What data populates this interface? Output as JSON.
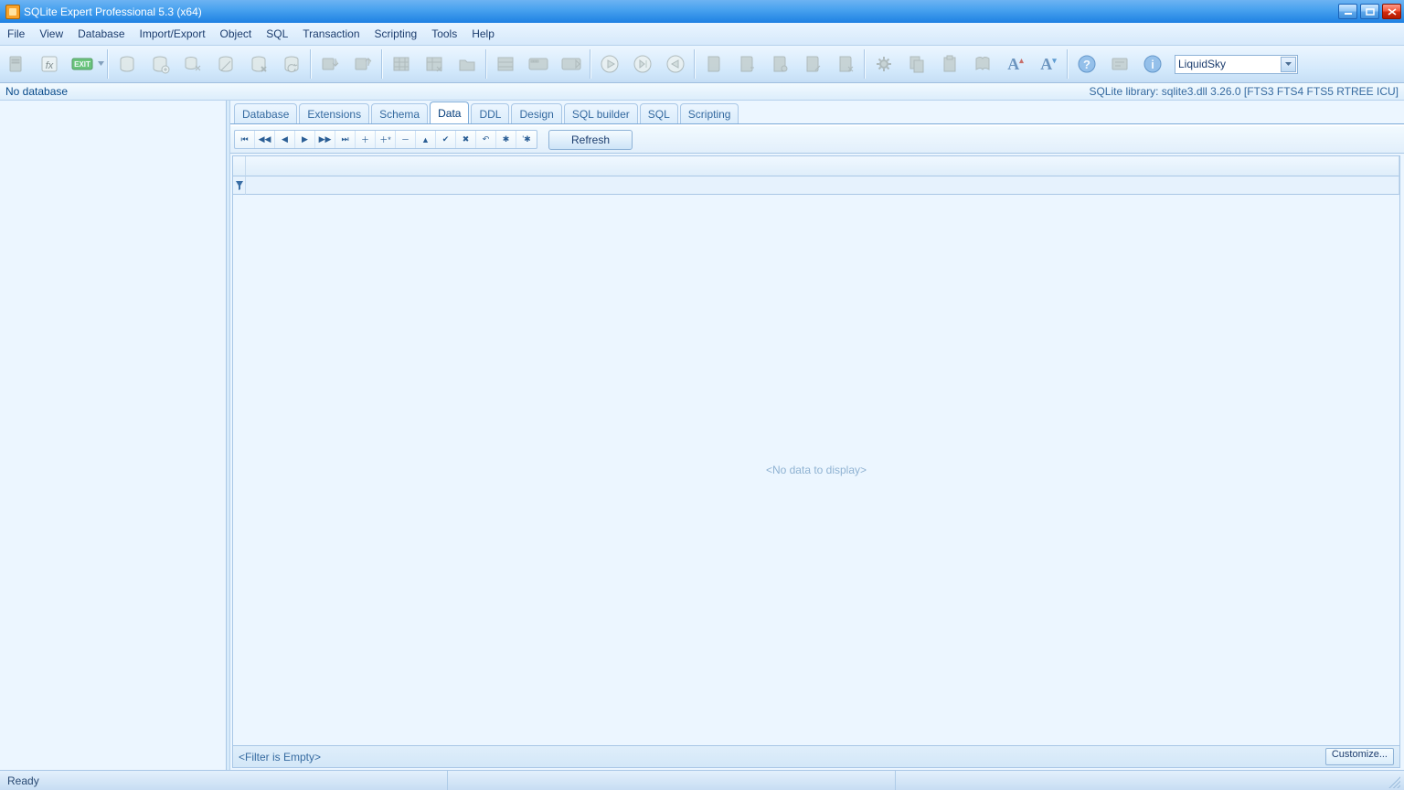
{
  "window": {
    "title": "SQLite Expert Professional 5.3 (x64)"
  },
  "menu": {
    "file": "File",
    "view": "View",
    "database": "Database",
    "import_export": "Import/Export",
    "object": "Object",
    "sql": "SQL",
    "transaction": "Transaction",
    "scripting": "Scripting",
    "tools": "Tools",
    "help": "Help"
  },
  "info": {
    "left": "No database",
    "right": "SQLite library: sqlite3.dll 3.26.0 [FTS3 FTS4 FTS5 RTREE ICU]"
  },
  "tabs": {
    "database": "Database",
    "extensions": "Extensions",
    "schema": "Schema",
    "data": "Data",
    "ddl": "DDL",
    "design": "Design",
    "sqlbuilder": "SQL builder",
    "sql": "SQL",
    "scripting": "Scripting"
  },
  "nav": {
    "refresh": "Refresh"
  },
  "grid": {
    "nodata": "<No data to display>",
    "filter": "<Filter is Empty>",
    "customize": "Customize..."
  },
  "statusbar": {
    "ready": "Ready"
  },
  "theme": {
    "selected": "LiquidSky"
  },
  "navglyphs": {
    "first": "⏮",
    "prevpage": "◀◀",
    "prev": "◀",
    "next": "▶",
    "nextpage": "▶▶",
    "last": "⏭",
    "insert": "＋",
    "append": "＋*",
    "delete": "－",
    "edit": "▲",
    "post": "✔",
    "cancel": "✖",
    "undo": "↶",
    "bookmark": "✱",
    "gotobm": "'✱"
  }
}
